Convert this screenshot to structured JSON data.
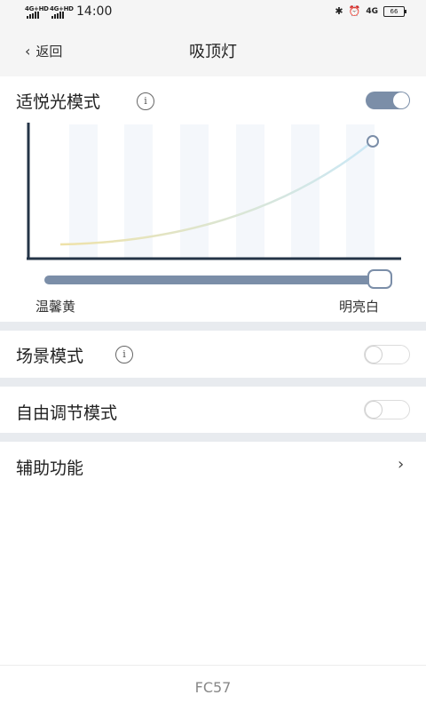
{
  "status": {
    "signal1": "4G+HD",
    "signal2": "4G+HD",
    "time": "14:00",
    "bt_icon": "bluetooth-icon",
    "alarm_icon": "alarm-icon",
    "network": "4G",
    "battery": "66"
  },
  "nav": {
    "back_label": "返回",
    "title": "吸顶灯"
  },
  "adaptive": {
    "title": "适悦光模式",
    "enabled": true,
    "left_label": "温馨黄",
    "right_label": "明亮白",
    "slider_value": 1.0
  },
  "scene": {
    "title": "场景模式",
    "enabled": false
  },
  "free": {
    "title": "自由调节模式",
    "enabled": false
  },
  "assist": {
    "title": "辅助功能"
  },
  "footer": {
    "model": "FC57"
  },
  "colors": {
    "accent": "#7b8ea8",
    "divider": "#e8ebef",
    "curve_start": "#efe2a8",
    "curve_end": "#cbe8f6"
  }
}
